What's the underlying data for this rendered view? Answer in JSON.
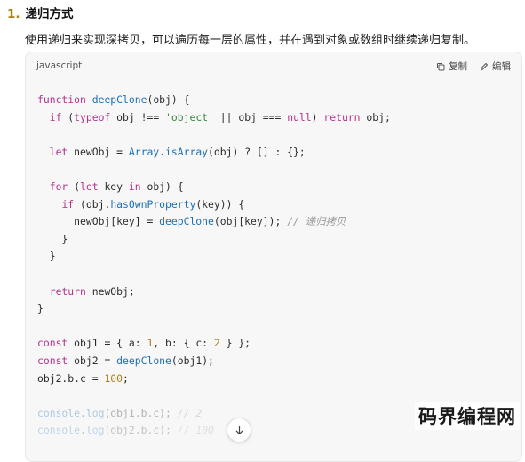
{
  "section": {
    "number": "1.",
    "title": "递归方式",
    "intro": "使用递归来实现深拷贝，可以遍历每一层的属性，并在遇到对象或数组时继续递归复制。"
  },
  "code_block": {
    "language": "javascript",
    "copy_label": "复制",
    "edit_label": "编辑",
    "copy_icon": "copy-icon",
    "edit_icon": "pencil-icon",
    "scroll_icon": "arrow-down-icon"
  },
  "code_lines": [
    "function deepClone(obj) {",
    "  if (typeof obj !== 'object' || obj === null) return obj;",
    "",
    "  let newObj = Array.isArray(obj) ? [] : {};",
    "",
    "  for (let key in obj) {",
    "    if (obj.hasOwnProperty(key)) {",
    "      newObj[key] = deepClone(obj[key]); // 递归拷贝",
    "    }",
    "  }",
    "",
    "  return newObj;",
    "}",
    "",
    "const obj1 = { a: 1, b: { c: 2 } };",
    "const obj2 = deepClone(obj1);",
    "obj2.b.c = 100;",
    "",
    "console.log(obj1.b.c); // 2",
    "console.log(obj2.b.c); // 100"
  ],
  "watermark": "码界编程网",
  "colors": {
    "keyword": "#b5318c",
    "function": "#1d6fb3",
    "string": "#2f8a3a",
    "number": "#b07d12",
    "comment": "#9a9a9a",
    "code_background": "#f7f7f8"
  }
}
